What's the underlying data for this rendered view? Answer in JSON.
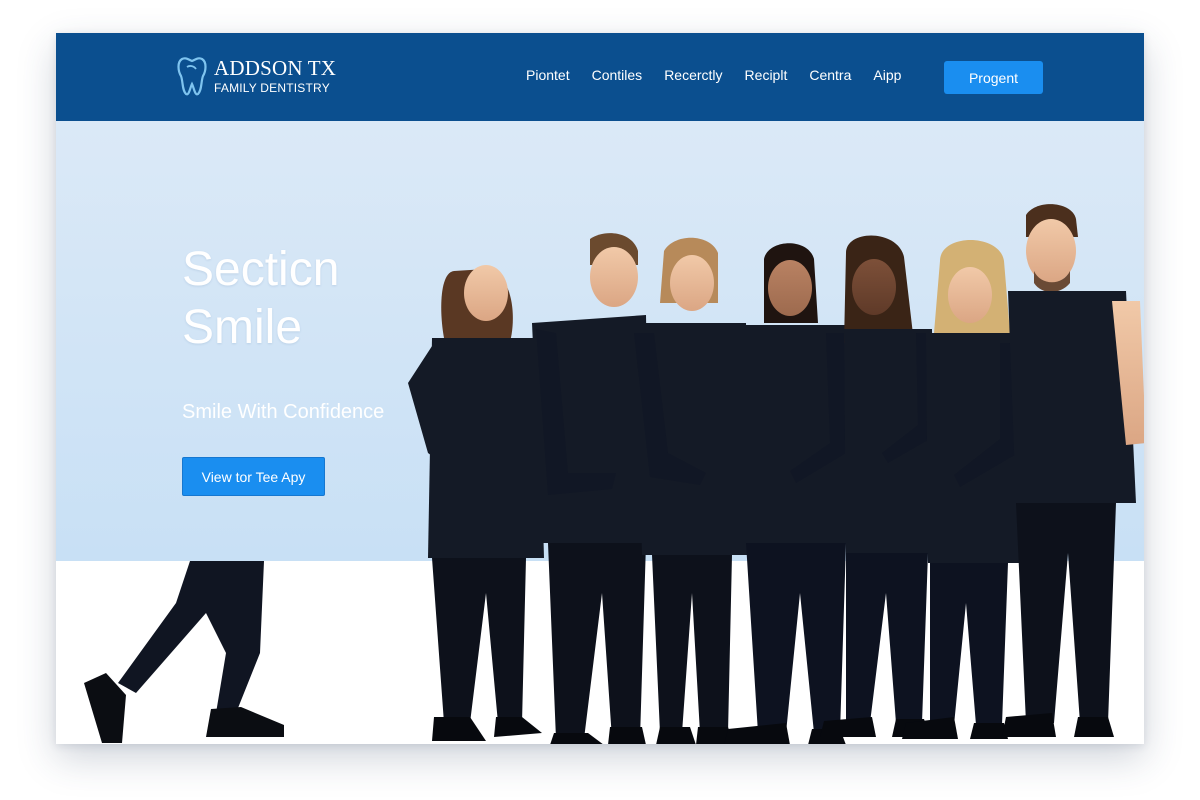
{
  "brand": {
    "name": "ADDSON TX",
    "tagline": "FAMILY DENTISTRY",
    "logo_icon": "tooth-icon"
  },
  "nav": {
    "items": [
      {
        "label": "Piontet"
      },
      {
        "label": "Contiles"
      },
      {
        "label": "Recerctly"
      },
      {
        "label": "Reciplt"
      },
      {
        "label": "Centra"
      },
      {
        "label": "Aipp"
      }
    ],
    "cta_label": "Progent"
  },
  "hero": {
    "title_line1": "Secticn",
    "title_line2": "Smile",
    "subtitle": "Smile With Confidence",
    "button_label": "View tor Tee Apy",
    "team_photo_icon": "team-photo-icon"
  },
  "colors": {
    "header_bg": "#0b4f8f",
    "accent": "#1a8ef0",
    "hero_bg": "#d3e6f6",
    "uniform": "#141a26"
  }
}
